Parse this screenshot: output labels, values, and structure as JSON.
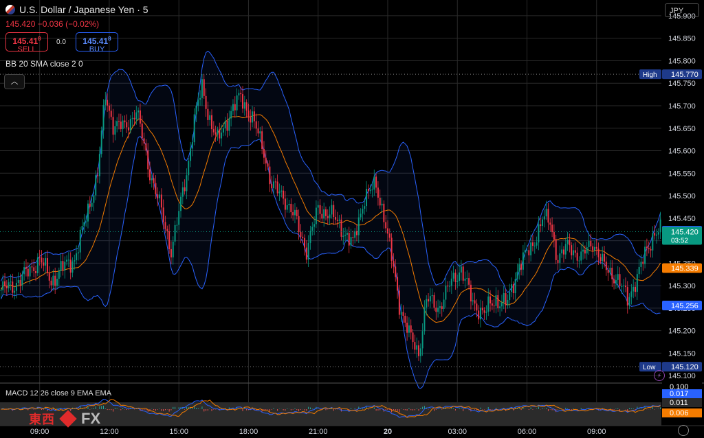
{
  "header": {
    "symbol": "U.S. Dollar / Japanese Yen · 5",
    "quote": "145.420  −0.036 (−0.02%)"
  },
  "trade": {
    "sell_price": "145.41",
    "sell_sup": "8",
    "sell_label": "SELL",
    "spread": "0.0",
    "buy_price": "145.41",
    "buy_sup": "8",
    "buy_label": "BUY"
  },
  "indicators": {
    "bb_label": "BB 20 SMA close 2 0",
    "macd_label": "MACD 12 26 close 9 EMA EMA"
  },
  "currency_button": "JPY",
  "logo": {
    "cn": "東西",
    "fx": "FX"
  },
  "chart_data": {
    "type": "candlestick",
    "ylim": [
      145.085,
      145.935
    ],
    "y_ticks": [
      145.9,
      145.85,
      145.8,
      145.75,
      145.7,
      145.65,
      145.6,
      145.55,
      145.5,
      145.45,
      145.4,
      145.35,
      145.3,
      145.25,
      145.2,
      145.15,
      145.1
    ],
    "x_ticks": [
      {
        "label": "09:00",
        "bar": 20
      },
      {
        "label": "12:00",
        "bar": 56
      },
      {
        "label": "15:00",
        "bar": 92
      },
      {
        "label": "18:00",
        "bar": 128
      },
      {
        "label": "21:00",
        "bar": 164
      },
      {
        "label": "20",
        "bar": 200
      },
      {
        "label": "03:00",
        "bar": 236
      },
      {
        "label": "06:00",
        "bar": 272
      },
      {
        "label": "09:00",
        "bar": 308
      }
    ],
    "close_path": [
      [
        0,
        145.29
      ],
      [
        6,
        145.3
      ],
      [
        14,
        145.33
      ],
      [
        20,
        145.36
      ],
      [
        26,
        145.31
      ],
      [
        32,
        145.34
      ],
      [
        38,
        145.36
      ],
      [
        44,
        145.45
      ],
      [
        50,
        145.55
      ],
      [
        54,
        145.72
      ],
      [
        58,
        145.66
      ],
      [
        64,
        145.65
      ],
      [
        70,
        145.69
      ],
      [
        76,
        145.57
      ],
      [
        82,
        145.48
      ],
      [
        88,
        145.38
      ],
      [
        92,
        145.46
      ],
      [
        96,
        145.55
      ],
      [
        100,
        145.67
      ],
      [
        104,
        145.74
      ],
      [
        108,
        145.67
      ],
      [
        112,
        145.62
      ],
      [
        118,
        145.68
      ],
      [
        124,
        145.72
      ],
      [
        130,
        145.67
      ],
      [
        136,
        145.6
      ],
      [
        140,
        145.52
      ],
      [
        146,
        145.5
      ],
      [
        152,
        145.45
      ],
      [
        158,
        145.38
      ],
      [
        164,
        145.47
      ],
      [
        170,
        145.46
      ],
      [
        176,
        145.43
      ],
      [
        182,
        145.39
      ],
      [
        188,
        145.5
      ],
      [
        194,
        145.52
      ],
      [
        198,
        145.46
      ],
      [
        202,
        145.36
      ],
      [
        206,
        145.26
      ],
      [
        212,
        145.18
      ],
      [
        216,
        145.15
      ],
      [
        220,
        145.27
      ],
      [
        226,
        145.25
      ],
      [
        232,
        145.3
      ],
      [
        238,
        145.34
      ],
      [
        244,
        145.26
      ],
      [
        250,
        145.24
      ],
      [
        256,
        145.27
      ],
      [
        262,
        145.26
      ],
      [
        268,
        145.35
      ],
      [
        274,
        145.38
      ],
      [
        280,
        145.45
      ],
      [
        284,
        145.44
      ],
      [
        288,
        145.36
      ],
      [
        294,
        145.39
      ],
      [
        300,
        145.36
      ],
      [
        306,
        145.4
      ],
      [
        312,
        145.34
      ],
      [
        318,
        145.32
      ],
      [
        324,
        145.27
      ],
      [
        330,
        145.33
      ],
      [
        334,
        145.38
      ],
      [
        338,
        145.42
      ]
    ],
    "bb_period": 20,
    "bb_mult": 2,
    "price_labels": [
      {
        "name": "High",
        "value": "145.770",
        "color": "#1e3a8a"
      },
      {
        "name": "",
        "value": "145.422",
        "color": "#2962ff"
      },
      {
        "name": "",
        "value": "145.420",
        "sub": "03:52",
        "color": "#089981"
      },
      {
        "name": "",
        "value": "145.339",
        "color": "#f57c00"
      },
      {
        "name": "",
        "value": "145.256",
        "color": "#2962ff"
      },
      {
        "name": "Low",
        "value": "145.120",
        "color": "#1e3a8a"
      }
    ],
    "macd_labels": [
      {
        "value": "0.100",
        "color": "#000000"
      },
      {
        "value": "0.017",
        "color": "#2962ff"
      },
      {
        "value": "0.011",
        "color": "#2a2a2a"
      },
      {
        "value": "0.006",
        "color": "#f57c00"
      }
    ],
    "colors": {
      "up": "#089981",
      "down": "#f23645",
      "bb_band": "#2962ff",
      "bb_basis": "#f57c00"
    }
  }
}
